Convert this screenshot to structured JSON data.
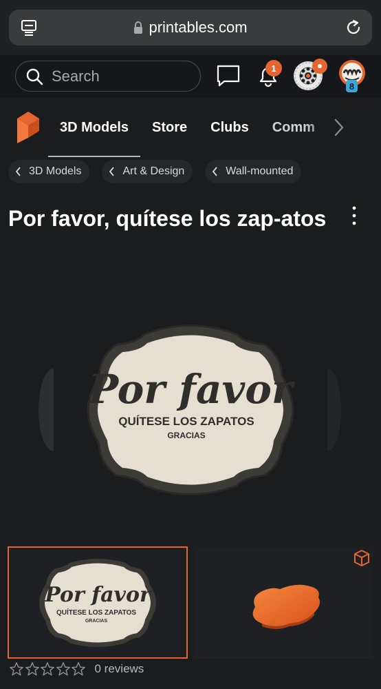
{
  "browser": {
    "url": "printables.com",
    "tabs_icon": "tabs-icon",
    "lock_icon": "lock-icon",
    "reload_icon": "reload-icon"
  },
  "header": {
    "search_placeholder": "Search",
    "notifications_count": "1",
    "spool_badge_label": "",
    "avatar_level": "8",
    "accent_color": "#e5652f"
  },
  "nav": {
    "items": [
      {
        "label": "3D Models",
        "active": true
      },
      {
        "label": "Store",
        "active": false
      },
      {
        "label": "Clubs",
        "active": false
      },
      {
        "label": "Comm",
        "active": false
      }
    ]
  },
  "breadcrumbs": [
    {
      "label": "3D Models"
    },
    {
      "label": "Art & Design"
    },
    {
      "label": "Wall-mounted"
    }
  ],
  "model": {
    "title": "Por favor, quítese los zap-atos",
    "sign_script": "Por favor",
    "sign_line": "QUÍTESE LOS ZAPATOS",
    "sign_small": "GRACIAS"
  },
  "thumbnails": [
    {
      "kind": "image",
      "selected": true
    },
    {
      "kind": "3d-preview",
      "selected": false,
      "icon": "cube-icon"
    }
  ],
  "reviews": {
    "rating": 0,
    "max": 5,
    "text": "0 reviews"
  }
}
